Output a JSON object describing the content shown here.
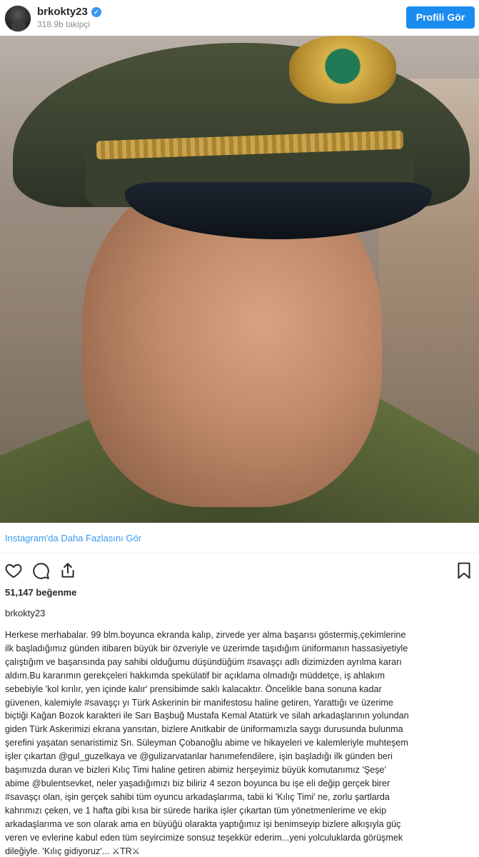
{
  "header": {
    "username": "brkokty23",
    "followers": "318.9b takipçi",
    "profile_button": "Profili Gör"
  },
  "post": {
    "more_link": "Instagram'da Daha Fazlasını Gör",
    "likes": "51,147 beğenme",
    "caption_user": "brkokty23",
    "caption_lines": [
      "Herkese merhabalar. 99 blm.boyunca ekranda kalıp, zirvede yer alma başarısı göstermiş,çekimlerine",
      "ilk başladığımız günden itibaren büyük bir özveriyle ve üzerimde taşıdığım üniformanın hassasiyetiyle",
      "çalıştığım ve başarısında pay sahibi olduğumu düşündüğüm #savaşçı adlı dizimizden ayrılma kararı",
      "aldım.Bu kararımın gerekçeleri hakkımda spekülatif bir açıklama olmadığı müddetçe, iş ahlakım",
      "sebebiyle 'kol kırılır, yen içinde kalır' prensibimde saklı kalacaktır. Öncelikle bana sonuna kadar",
      "güvenen, kalemiyle #savaşçı yı Türk Askerinin bir manifestosu haline getiren, Yarattığı ve üzerime",
      "biçtiği Kağan Bozok karakteri ile Sarı Başbuğ Mustafa Kemal Atatürk ve silah arkadaşlarının yolundan",
      "giden Türk Askerimizi ekrana yansıtan, bizlere Anıtkabir de üniformamızla saygı durusunda bulunma",
      "şerefini yaşatan senaristimiz Sn. Süleyman Çobanoğlu abime ve hikayeleri ve kalemleriyle muhteşem",
      "işler çıkartan @gul_guzelkaya ve @gulizarvatanlar hanımefendilere, işin başladığı ilk günden beri",
      "başımızda duran ve bizleri Kılıç Timi haline getiren abimiz herşeyimiz büyük komutanımız 'Şeşe'",
      "abime @bulentsevket, neler yaşadığımızı biz biliriz 4 sezon boyunca bu işe eli değip gerçek birer",
      "#savaşçı olan, işin gerçek sahibi tüm oyuncu arkadaşlarıma, tabii ki 'Kılıç Timi' ne, zorlu şartlarda",
      "kahrımızı çeken, ve 1 hafta gibi kısa bir sürede harika işler çıkartan tüm yönetmenlerime ve ekip",
      "arkadaşlarıma ve son olarak ama en büyüğü olarakta yaptığımız işi benimseyip bizlere alkışıyla güç",
      "veren ve evlerine kabul eden tüm seyircimize sonsuz teşekkür ederim...yeni yolculuklarda görüşmek",
      "dileğiyle. 'Kılıç gidiyoruz'... ⚔TR⚔"
    ]
  },
  "icons": {
    "verified": "verified-badge-icon",
    "like": "heart-icon",
    "comment": "comment-icon",
    "share": "share-icon",
    "save": "bookmark-icon"
  },
  "colors": {
    "accent": "#3897f0",
    "button": "#1a8cf0",
    "text": "#262626",
    "muted": "#8e8e8e"
  }
}
